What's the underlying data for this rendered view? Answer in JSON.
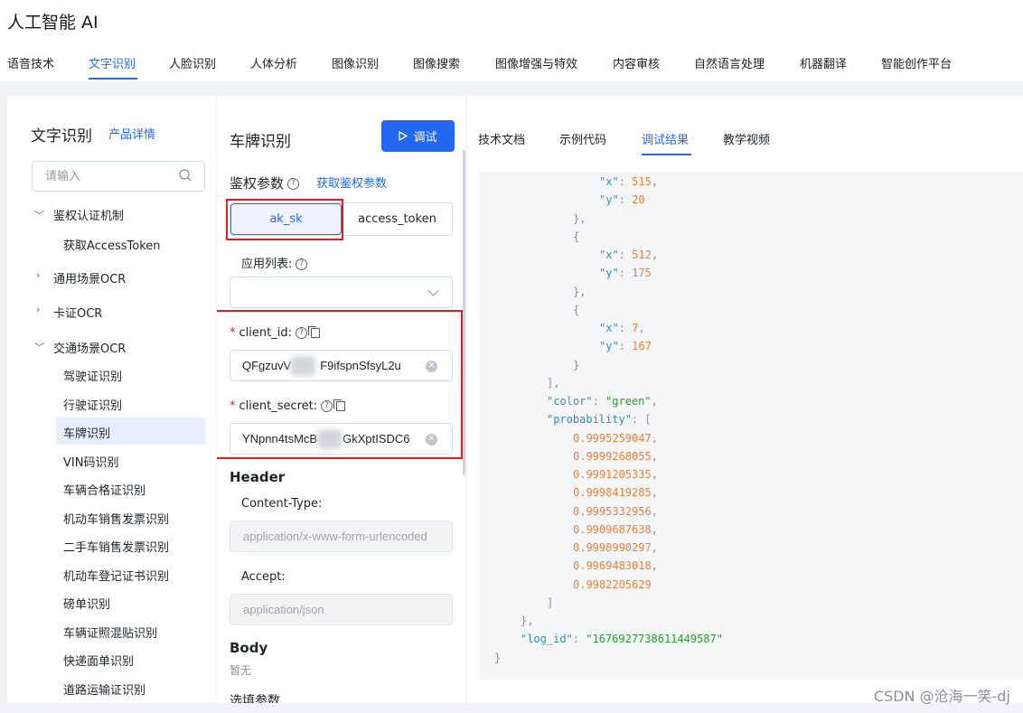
{
  "app_title": "人工智能 AI",
  "nav": [
    {
      "label": "语音技术",
      "active": false
    },
    {
      "label": "文字识别",
      "active": true
    },
    {
      "label": "人脸识别",
      "active": false
    },
    {
      "label": "人体分析",
      "active": false
    },
    {
      "label": "图像识别",
      "active": false
    },
    {
      "label": "图像搜索",
      "active": false
    },
    {
      "label": "图像增强与特效",
      "active": false
    },
    {
      "label": "内容审核",
      "active": false
    },
    {
      "label": "自然语言处理",
      "active": false
    },
    {
      "label": "机器翻译",
      "active": false
    },
    {
      "label": "智能创作平台",
      "active": false
    }
  ],
  "sidebar": {
    "title": "文字识别",
    "detail_link": "产品详情",
    "search_placeholder": "请输入",
    "groups": [
      {
        "label": "鉴权认证机制",
        "expanded": true,
        "children": [
          "获取AccessToken"
        ]
      },
      {
        "label": "通用场景OCR",
        "expanded": false
      },
      {
        "label": "卡证OCR",
        "expanded": false
      },
      {
        "label": "交通场景OCR",
        "expanded": true,
        "children": [
          "驾驶证识别",
          "行驶证识别",
          "车牌识别",
          "VIN码识别",
          "车辆合格证识别",
          "机动车销售发票识别",
          "二手车销售发票识别",
          "机动车登记证书识别",
          "磅单识别",
          "车辆证照混贴识别",
          "快递面单识别",
          "道路运输证识别"
        ]
      }
    ],
    "active_item": "车牌识别"
  },
  "middle": {
    "title": "车牌识别",
    "debug_button": "调试",
    "auth_label": "鉴权参数",
    "auth_link": "获取鉴权参数",
    "auth_modes": [
      "ak_sk",
      "access_token"
    ],
    "active_mode": "ak_sk",
    "app_list_label": "应用列表:",
    "client_id_label": "client_id:",
    "client_id_value": "QFgzuvV",
    "client_id_value_tail": "F9ifspnSfsyL2u",
    "client_secret_label": "client_secret:",
    "client_secret_value": "YNpnn4tsMcB",
    "client_secret_value_tail": "GkXptISDC6",
    "header_label": "Header",
    "content_type_label": "Content-Type:",
    "content_type_value": "application/x-www-form-urlencoded",
    "accept_label": "Accept:",
    "accept_value": "application/json",
    "body_label": "Body",
    "body_empty": "暂无",
    "optional_label": "选填参数"
  },
  "right": {
    "tabs": [
      "技术文档",
      "示例代码",
      "调试结果",
      "教学视频"
    ],
    "active_tab": "调试结果"
  },
  "result_json": {
    "points": [
      {
        "x": "515",
        "y": "20"
      },
      {
        "x": "512",
        "y": "175"
      },
      {
        "x": "7",
        "y": "167"
      }
    ],
    "color": "green",
    "probability": [
      "0.9995259047",
      "0.9999268055",
      "0.9991205335",
      "0.9998419285",
      "0.9995332956",
      "0.9909687638",
      "0.9998990297",
      "0.9969483018",
      "0.9982205629"
    ],
    "log_id": "1676927738611449587"
  },
  "watermark": "CSDN @沧海一笑-dj"
}
